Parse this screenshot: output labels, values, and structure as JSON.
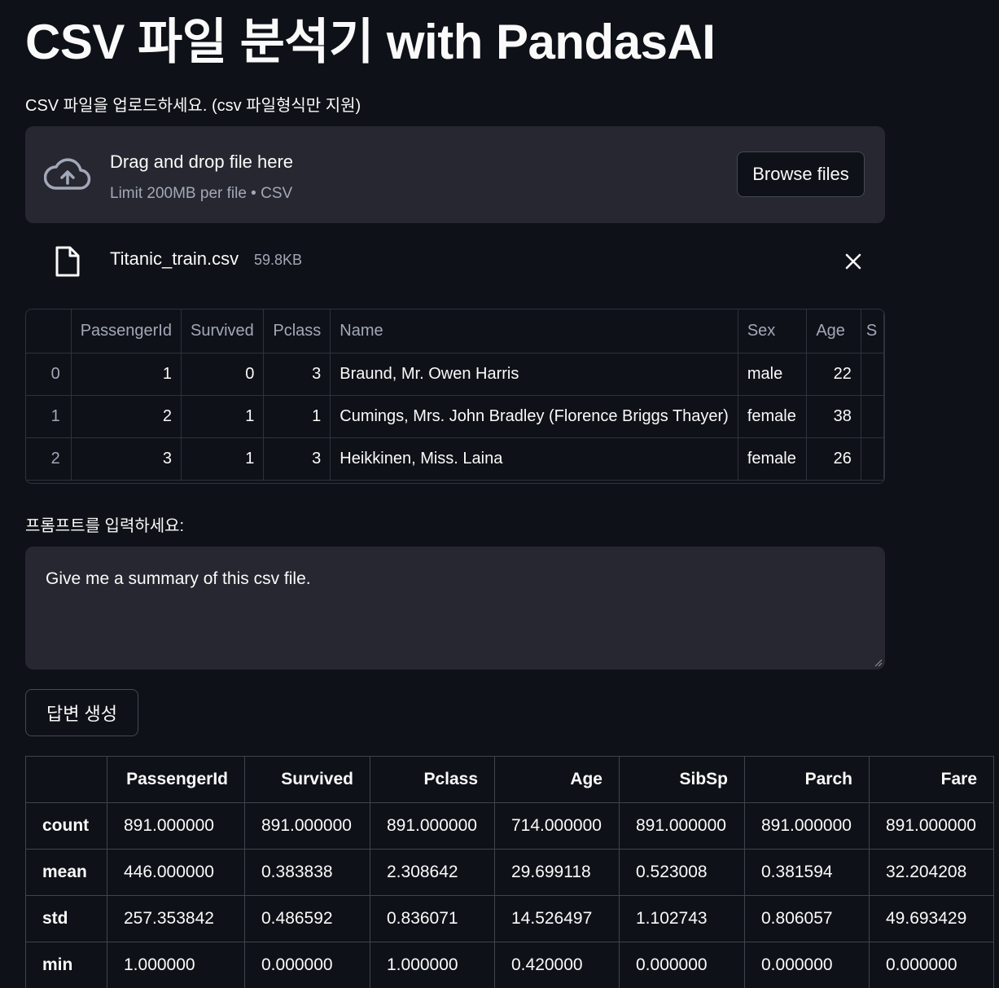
{
  "page": {
    "title": "CSV 파일 분석기 with PandasAI"
  },
  "uploader": {
    "label": "CSV 파일을 업로드하세요. (csv 파일형식만 지원)",
    "drop_text": "Drag and drop file here",
    "limit_text": "Limit 200MB per file • CSV",
    "browse_label": "Browse files",
    "icon": "cloud-upload-icon"
  },
  "uploaded_file": {
    "name": "Titanic_train.csv",
    "size": "59.8KB",
    "icon": "file-icon"
  },
  "preview": {
    "columns": [
      "",
      "PassengerId",
      "Survived",
      "Pclass",
      "Name",
      "Sex",
      "Age",
      "S"
    ],
    "rows": [
      [
        "0",
        "1",
        "0",
        "3",
        "Braund, Mr. Owen Harris",
        "male",
        "22"
      ],
      [
        "1",
        "2",
        "1",
        "1",
        "Cumings, Mrs. John Bradley (Florence Briggs Thayer)",
        "female",
        "38"
      ],
      [
        "2",
        "3",
        "1",
        "3",
        "Heikkinen, Miss. Laina",
        "female",
        "26"
      ]
    ]
  },
  "prompt": {
    "label": "프롬프트를 입력하세요:",
    "value": "Give me a summary of this csv file."
  },
  "generate_button": {
    "label": "답변 생성"
  },
  "summary": {
    "columns": [
      "",
      "PassengerId",
      "Survived",
      "Pclass",
      "Age",
      "SibSp",
      "Parch",
      "Fare"
    ],
    "rows": [
      [
        "count",
        "891.000000",
        "891.000000",
        "891.000000",
        "714.000000",
        "891.000000",
        "891.000000",
        "891.000000"
      ],
      [
        "mean",
        "446.000000",
        "0.383838",
        "2.308642",
        "29.699118",
        "0.523008",
        "0.381594",
        "32.204208"
      ],
      [
        "std",
        "257.353842",
        "0.486592",
        "0.836071",
        "14.526497",
        "1.102743",
        "0.806057",
        "49.693429"
      ],
      [
        "min",
        "1.000000",
        "0.000000",
        "1.000000",
        "0.420000",
        "0.000000",
        "0.000000",
        "0.000000"
      ]
    ]
  }
}
